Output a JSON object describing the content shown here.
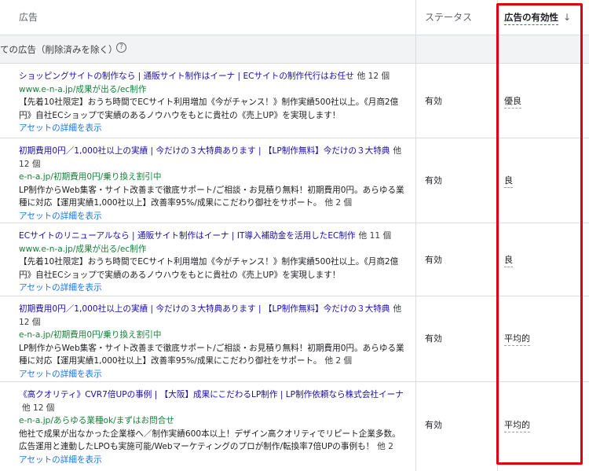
{
  "header": {
    "col_ad": "広告",
    "col_status": "ステータス",
    "col_effectiveness": "広告の有効性",
    "sort_arrow": "↓"
  },
  "subheader": {
    "text": "ての広告（削除済みを除く）",
    "help": "?"
  },
  "rows": [
    {
      "title": "ショッピングサイトの制作なら | 通販サイト制作はイーナ | ECサイトの制作代行はお任せ",
      "title_more": "他 12 個",
      "url": "www.e-n-a.jp/成果が出る/ec制作",
      "desc": "【先着10社限定】おうち時間でECサイト利用増加《今がチャンス！》制作実績500社以上。《月商2億円》自社ECショップで実績のあるノウハウをもとに貴社の《売上UP》を実現します！",
      "desc_more": "",
      "link": "アセットの詳細を表示",
      "status": "有効",
      "effectiveness": "優良"
    },
    {
      "title": "初期費用0円／1,000社以上の実績 | 今だけの３大特典あります | 【LP制作無料】今だけの３大特典",
      "title_more": "他 12 個",
      "url": "e-n-a.jp/初期費用0円/乗り換え割引中",
      "desc": "LP制作からWeb集客・サイト改善まで徹底サポート/ご相談・お見積り無料！初期費用0円。あらゆる業種に対応【運用実績1,000社以上】改善率95%/成果にこだわり御社をサポート。",
      "desc_more": "他 2 個",
      "link": "アセットの詳細を表示",
      "status": "有効",
      "effectiveness": "良"
    },
    {
      "title": "ECサイトのリニューアルなら | 通販サイト制作はイーナ | IT導入補助金を活用したEC制作",
      "title_more": "他 11 個",
      "url": "www.e-n-a.jp/成果が出る/ec制作",
      "desc": "【先着10社限定】おうち時間でECサイト利用増加《今がチャンス！》制作実績500社以上。《月商2億円》自社ECショップで実績のあるノウハウをもとに貴社の《売上UP》を実現します！",
      "desc_more": "",
      "link": "アセットの詳細を表示",
      "status": "有効",
      "effectiveness": "良"
    },
    {
      "title": "初期費用0円／1,000社以上の実績 | 今だけの３大特典あります | 【LP制作無料】今だけの３大特典",
      "title_more": "他 12 個",
      "url": "e-n-a.jp/初期費用0円/乗り換え割引中",
      "desc": "LP制作からWeb集客・サイト改善まで徹底サポート/ご相談・お見積り無料！初期費用0円。あらゆる業種に対応【運用実績1,000社以上】改善率95%/成果にこだわり御社をサポート。",
      "desc_more": "他 2 個",
      "link": "アセットの詳細を表示",
      "status": "有効",
      "effectiveness": "平均的"
    },
    {
      "title": "《高クオリティ》CVR7倍UPの事例 | 【大阪】成果にこだわるLP制作 | LP制作依頼なら株式会社イーナ",
      "title_more": "他 12 個",
      "url": "e-n-a.jp/あらゆる業種ok/まずはお問合せ",
      "desc": "他社で成果が出なかった企業様へ／制作実績600本以上！デザイン高クオリティでリピート企業多数。広告運用と連動したLPOも実施可能/Webマーケティングのプロが制作/転換率7倍UPの事例も！",
      "desc_more": "他 2",
      "link": "アセットの詳細を表示",
      "status": "有効",
      "effectiveness": "平均的"
    }
  ]
}
